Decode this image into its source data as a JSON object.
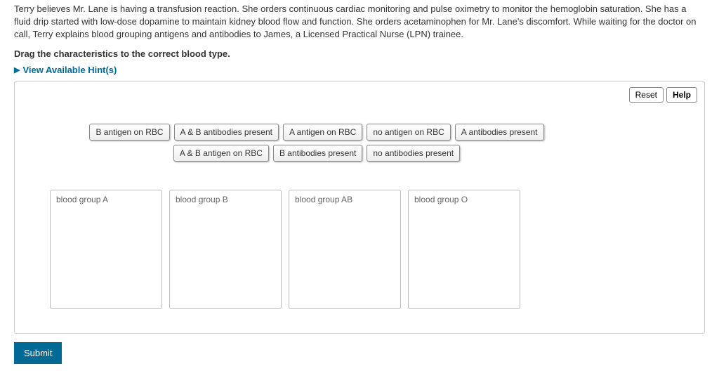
{
  "scenario": "Terry believes Mr. Lane is having a transfusion reaction.  She orders continuous cardiac monitoring and pulse oximetry to monitor the hemoglobin saturation. She has a fluid drip started with low-dose dopamine to maintain kidney blood flow and function.  She orders acetaminophen for Mr. Lane's discomfort. While waiting for the doctor on call, Terry explains blood grouping antigens and antibodies to James, a Licensed Practical Nurse (LPN) trainee.",
  "instruction": "Drag the characteristics to the correct blood type.",
  "hints_label": "View Available Hint(s)",
  "buttons": {
    "reset": "Reset",
    "help": "Help",
    "submit": "Submit"
  },
  "items": [
    "B antigen on RBC",
    "A & B antibodies present",
    "A antigen on RBC",
    "no antigen on RBC",
    "A antibodies present",
    "A & B antigen on RBC",
    "B antibodies present",
    "no antibodies present"
  ],
  "bins": [
    "blood group A",
    "blood group B",
    "blood group AB",
    "blood group O"
  ]
}
